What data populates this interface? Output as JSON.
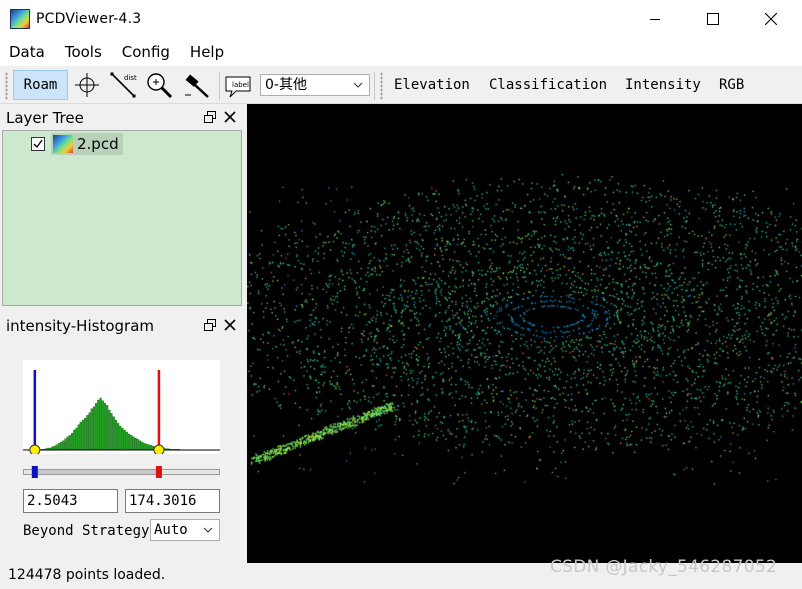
{
  "window": {
    "title": "PCDViewer-4.3"
  },
  "menu": [
    "Data",
    "Tools",
    "Config",
    "Help"
  ],
  "toolbar": {
    "roam_label": "Roam",
    "class_select_value": "0-其他",
    "modes": [
      "Elevation",
      "Classification",
      "Intensity",
      "RGB"
    ]
  },
  "layer_tree": {
    "title": "Layer Tree",
    "items": [
      {
        "name": "2.pcd",
        "checked": true
      }
    ]
  },
  "histogram": {
    "title": "intensity-Histogram",
    "min_value": "2.5043",
    "max_value": "174.3016",
    "beyond_label": "Beyond Strategy",
    "strategy_value": "Auto",
    "low_fraction": 0.06,
    "high_fraction": 0.69,
    "bins": [
      0,
      0,
      0,
      0,
      0,
      0,
      0,
      0,
      1,
      1,
      2,
      3,
      3,
      5,
      6,
      8,
      10,
      12,
      14,
      17,
      20,
      22,
      25,
      30,
      33,
      38,
      42,
      45,
      48,
      52,
      56,
      62,
      65,
      70,
      75,
      78,
      74,
      70,
      67,
      60,
      55,
      50,
      45,
      40,
      36,
      33,
      30,
      27,
      24,
      22,
      20,
      18,
      16,
      14,
      12,
      10,
      9,
      8,
      7,
      6,
      5,
      4,
      4,
      3,
      3,
      2,
      2,
      1,
      1,
      1,
      1,
      1,
      0,
      0,
      0,
      0,
      0,
      0,
      0,
      0,
      0,
      0,
      0,
      0,
      0,
      0,
      0,
      0,
      0,
      0
    ]
  },
  "colors": {
    "selection": "#cce4f7",
    "layer_bg": "#cce8cf",
    "low_marker": "#1010c0",
    "high_marker": "#e01010",
    "bar_fill": "#23a023"
  },
  "status": {
    "text": "124478 points loaded."
  },
  "watermark": "CSDN @Jacky_546287052"
}
